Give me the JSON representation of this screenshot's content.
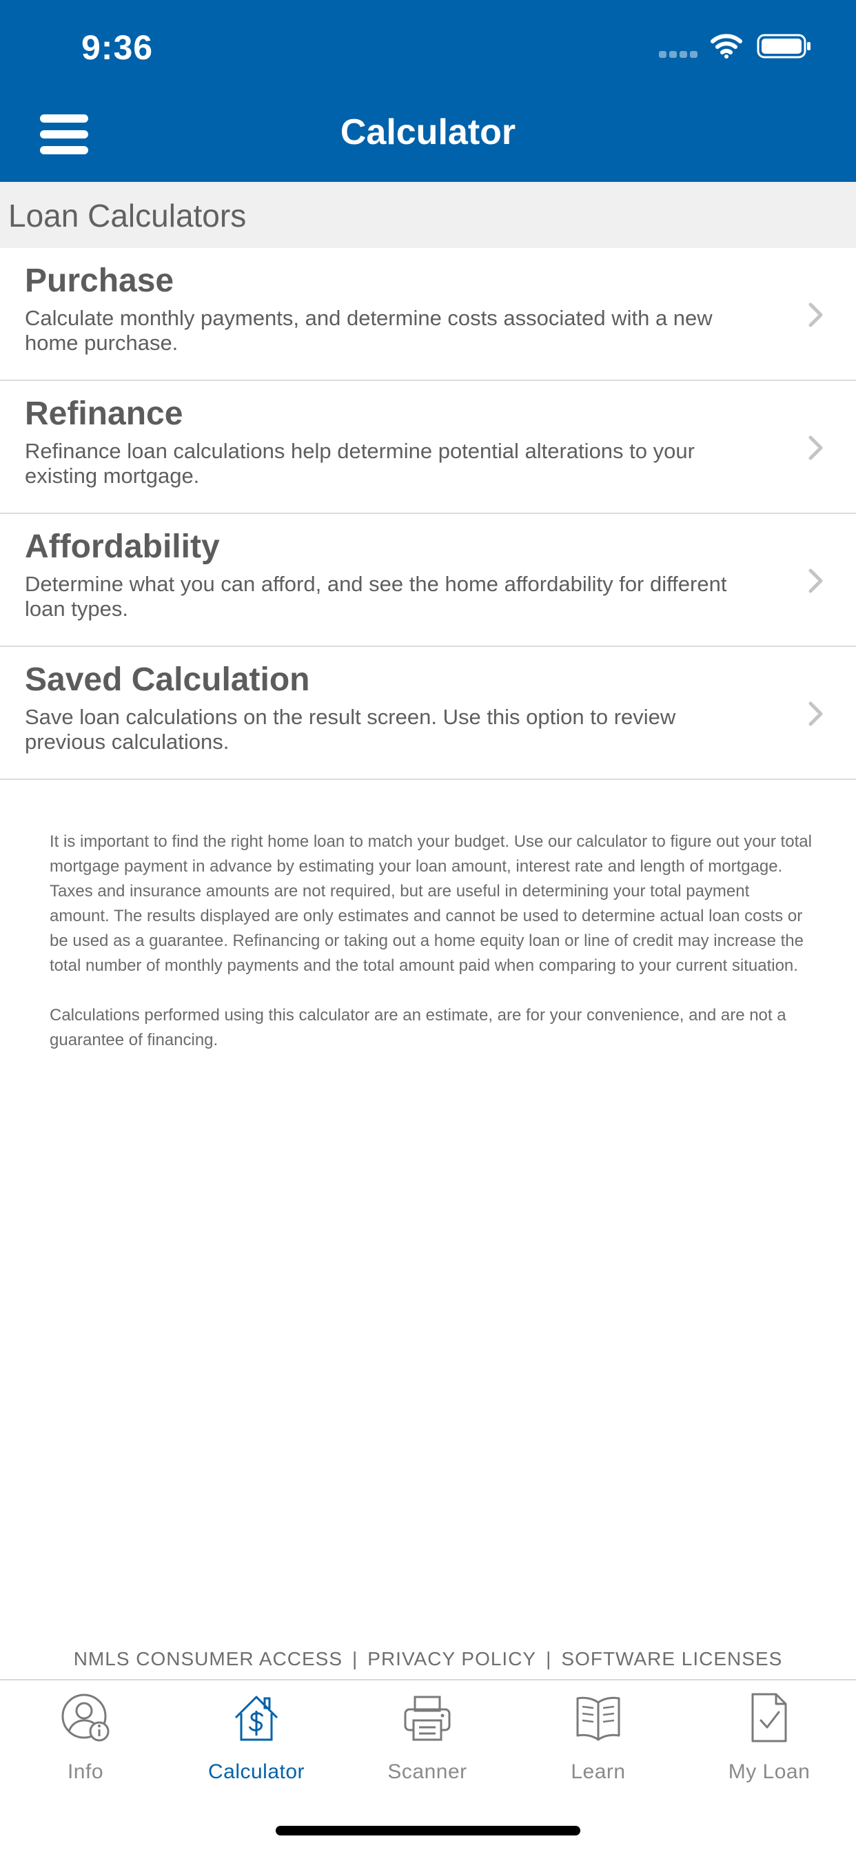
{
  "status_bar": {
    "time": "9:36"
  },
  "nav": {
    "title": "Calculator"
  },
  "section": {
    "title": "Loan Calculators"
  },
  "calculators": [
    {
      "title": "Purchase",
      "description": "Calculate monthly payments, and determine costs associated with a new home purchase."
    },
    {
      "title": "Refinance",
      "description": "Refinance loan calculations help determine potential alterations to your existing mortgage."
    },
    {
      "title": "Affordability",
      "description": "Determine what you can afford, and see the home affordability for different loan types."
    },
    {
      "title": "Saved Calculation",
      "description": "Save loan calculations on the result screen. Use this option to review previous calculations."
    }
  ],
  "disclaimer": {
    "paragraph1": "It is important to find the right home loan to match your budget. Use our calculator to figure out your total mortgage payment in advance by estimating your loan amount, interest rate and length of mortgage. Taxes and insurance amounts are not required, but are useful in determining your total payment amount. The results displayed are only estimates and cannot be used to determine actual loan costs or be used as a guarantee. Refinancing or taking out a home equity loan or line of credit may increase the total number of monthly payments and the total amount paid when comparing to your current situation.",
    "paragraph2": "Calculations performed using this calculator are an estimate, are for your convenience, and are not a guarantee of financing."
  },
  "footer": {
    "nmls": "NMLS CONSUMER ACCESS",
    "privacy": "PRIVACY POLICY",
    "licenses": "SOFTWARE LICENSES",
    "separator": "|"
  },
  "tabs": [
    {
      "label": "Info",
      "icon": "info-user-icon",
      "active": false
    },
    {
      "label": "Calculator",
      "icon": "house-dollar-icon",
      "active": true
    },
    {
      "label": "Scanner",
      "icon": "printer-icon",
      "active": false
    },
    {
      "label": "Learn",
      "icon": "book-icon",
      "active": false
    },
    {
      "label": "My Loan",
      "icon": "document-check-icon",
      "active": false
    }
  ],
  "colors": {
    "brand": "#0062aa",
    "section_bg": "#f0f0f0",
    "text": "#5e5e5e",
    "tab_inactive": "#8a8a8a"
  }
}
